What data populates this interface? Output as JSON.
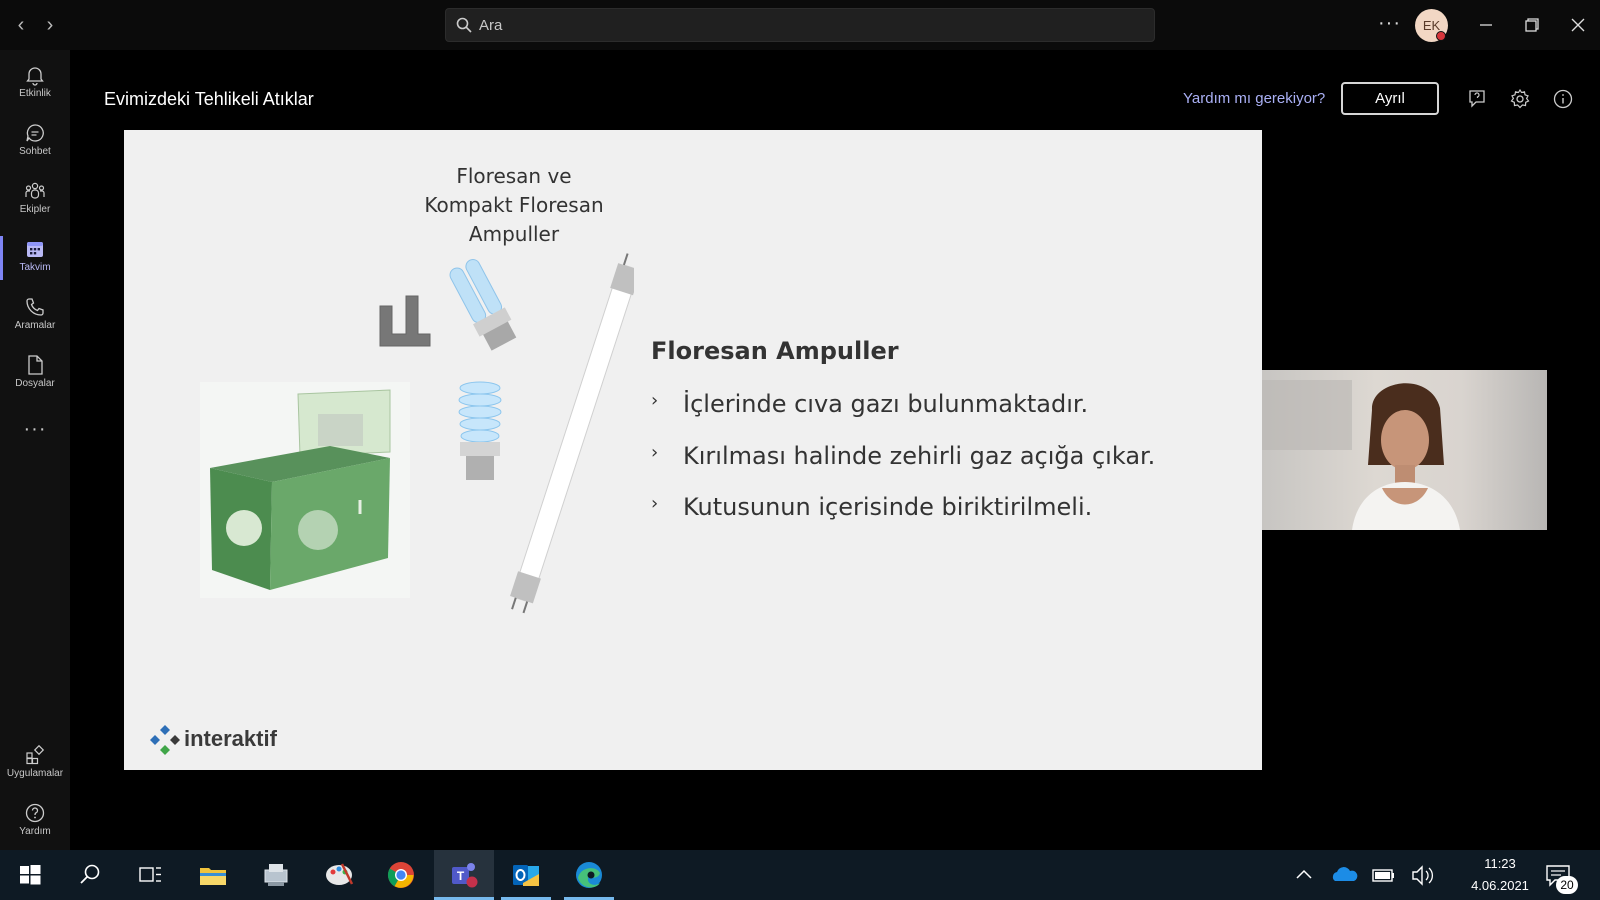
{
  "search": {
    "placeholder": "Ara"
  },
  "user": {
    "initials": "EK",
    "status_color": "#d7363c"
  },
  "rail": {
    "items": [
      {
        "label": "Etkinlik",
        "icon": "bell-icon"
      },
      {
        "label": "Sohbet",
        "icon": "chat-icon"
      },
      {
        "label": "Ekipler",
        "icon": "teams-icon"
      },
      {
        "label": "Takvim",
        "icon": "calendar-icon",
        "active": true
      },
      {
        "label": "Aramalar",
        "icon": "phone-icon"
      },
      {
        "label": "Dosyalar",
        "icon": "file-icon"
      }
    ],
    "more": "···",
    "apps_label": "Uygulamalar",
    "help_label": "Yardım"
  },
  "meeting": {
    "title": "Evimizdeki Tehlikeli Atıklar",
    "help_link": "Yardım mı gerekiyor?",
    "leave_label": "Ayrıl"
  },
  "slide": {
    "caption": "Floresan ve\nKompakt Floresan\nAmpuller",
    "heading": "Floresan Ampuller",
    "bullets": [
      "İçlerinde cıva gazı bulunmaktadır.",
      "Kırılması halinde zehirli gaz açığa çıkar.",
      "Kutusunun içerisinde biriktirilmeli."
    ],
    "bullet_mark": "›",
    "logo_text": "interaktif"
  },
  "taskbar": {
    "time": "11:23",
    "date": "4.06.2021",
    "notification_count": "20"
  },
  "colors": {
    "accent": "#7f85f5",
    "taskbar": "#0e1a24"
  }
}
